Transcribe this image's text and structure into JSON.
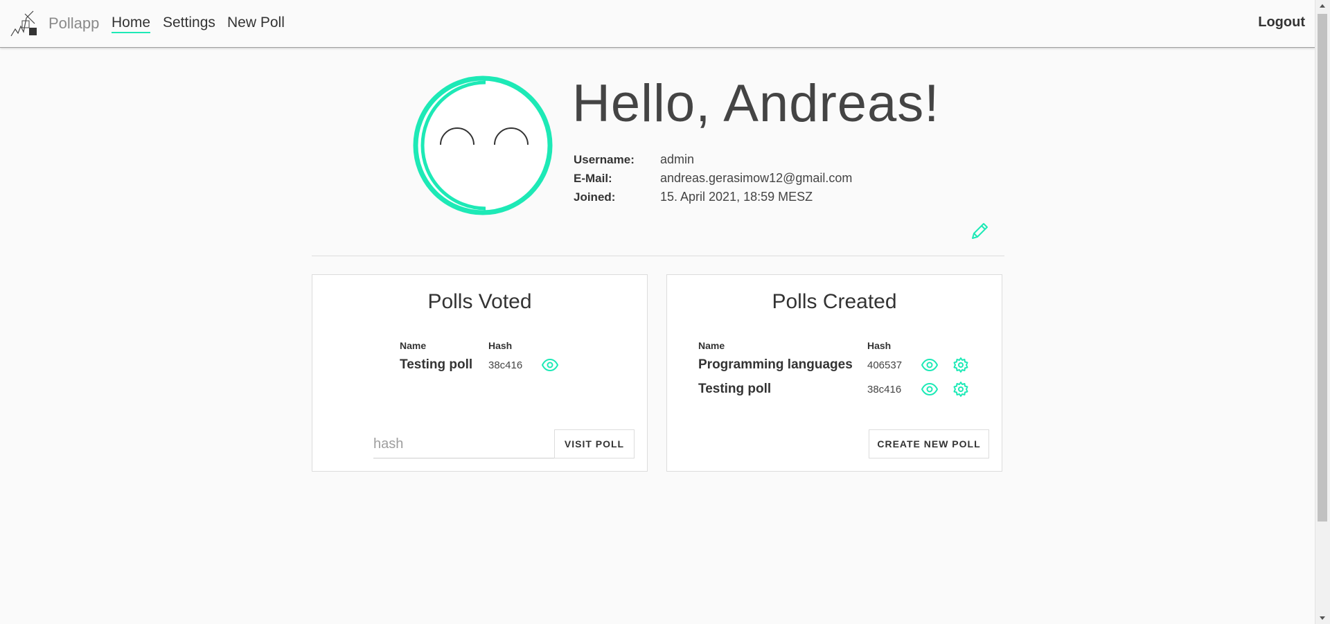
{
  "nav": {
    "brand": "Pollapp",
    "links": [
      {
        "label": "Home",
        "active": true
      },
      {
        "label": "Settings",
        "active": false
      },
      {
        "label": "New Poll",
        "active": false
      }
    ],
    "logout": "Logout"
  },
  "profile": {
    "greeting": "Hello, Andreas!",
    "fields": [
      {
        "label": "Username:",
        "value": "admin"
      },
      {
        "label": "E-Mail:",
        "value": "andreas.gerasimow12@gmail.com"
      },
      {
        "label": "Joined:",
        "value": "15. April 2021, 18:59 MESZ"
      }
    ],
    "edit_icon": "pencil-icon"
  },
  "polls_voted": {
    "title": "Polls Voted",
    "col_name": "Name",
    "col_hash": "Hash",
    "rows": [
      {
        "name": "Testing poll",
        "hash": "38c416"
      }
    ],
    "input_placeholder": "hash",
    "button": "VISIT POLL"
  },
  "polls_created": {
    "title": "Polls Created",
    "col_name": "Name",
    "col_hash": "Hash",
    "rows": [
      {
        "name": "Programming languages",
        "hash": "406537"
      },
      {
        "name": "Testing poll",
        "hash": "38c416"
      }
    ],
    "button": "CREATE NEW POLL"
  },
  "colors": {
    "accent": "#1de9b6",
    "background": "#fafafa",
    "text": "#333333"
  }
}
